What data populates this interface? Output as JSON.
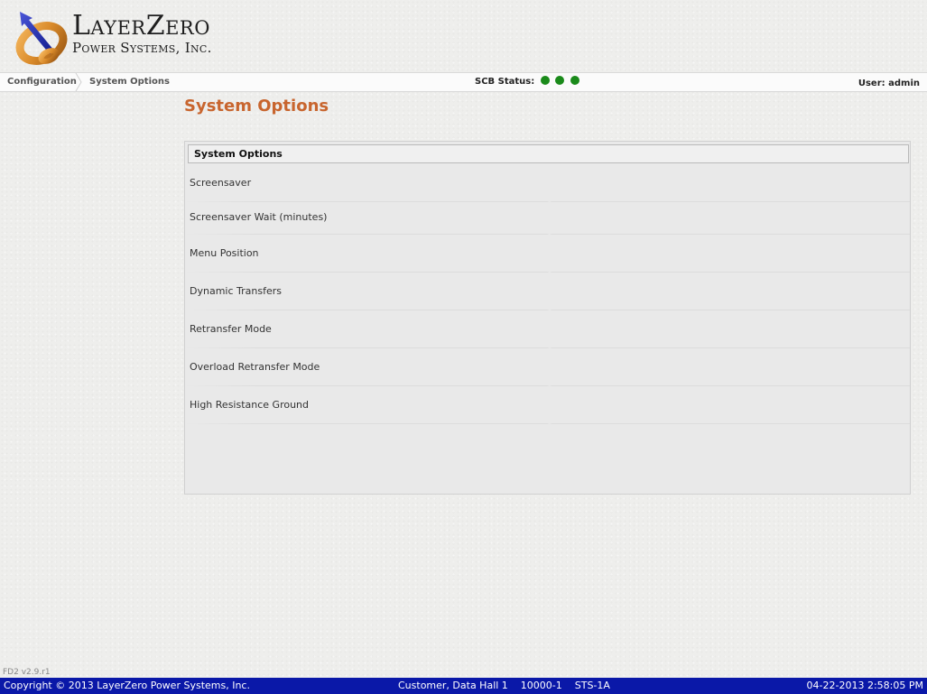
{
  "brand": {
    "line1": "LayerZero",
    "line2": "Power Systems, Inc.",
    "logo_icon": "layerzero-logo-icon"
  },
  "nav": {
    "breadcrumb": [
      "Configuration",
      "System Options"
    ],
    "scb_status_label": "SCB Status:",
    "scb_status_dots": [
      "#1a8a1a",
      "#1a8a1a",
      "#1a8a1a"
    ],
    "user_label": "User: admin"
  },
  "page": {
    "title": "System Options"
  },
  "panel": {
    "header": "System Options",
    "options": [
      {
        "label": "Screensaver"
      },
      {
        "label": "Screensaver Wait (minutes)"
      },
      {
        "label": "Menu Position"
      },
      {
        "label": "Dynamic Transfers"
      },
      {
        "label": "Retransfer Mode"
      },
      {
        "label": "Overload Retransfer Mode"
      },
      {
        "label": "High Resistance Ground"
      }
    ]
  },
  "footer": {
    "version": "FD2 v2.9.r1",
    "copyright": "Copyright © 2013 LayerZero Power Systems, Inc.",
    "location": "Customer, Data Hall 1    10000-1    STS-1A",
    "datetime": "04-22-2013 2:58:05 PM"
  },
  "colors": {
    "title_accent": "#c8652e",
    "status_bar": "#0a18a8",
    "status_ok": "#1a8a1a"
  }
}
